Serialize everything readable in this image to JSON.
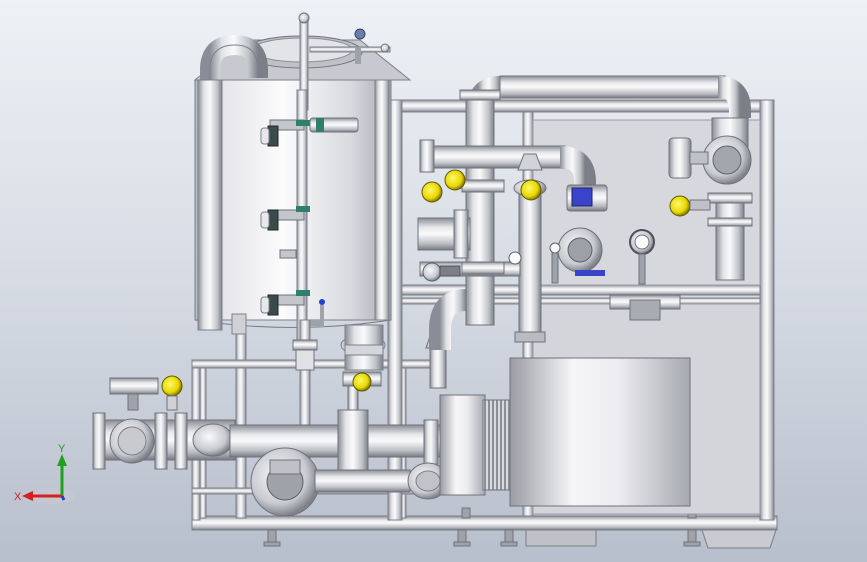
{
  "viewport": {
    "background_top": "#eef1f5",
    "background_bottom": "#b7bfcc"
  },
  "colors": {
    "steel_light": "#f4f4f6",
    "steel_mid": "#c4c6cc",
    "steel_dark": "#7c7f88",
    "frame_light": "#e9eaee",
    "frame_dark": "#9a9ca4",
    "valve_yellow": "#f2e200",
    "valve_dark": "#404040",
    "gauge_blue": "#3a44c8",
    "axis_x": "#d42020",
    "axis_y": "#20a020",
    "axis_z": "#2040d0"
  },
  "icons": {
    "storage_tank": "storage-tank-icon",
    "pump_motor": "motor-icon",
    "centrifugal_pump": "pump-icon",
    "butterfly_valve": "butterfly-valve-icon",
    "pressure_gauge": "pressure-gauge-icon",
    "axis_triad": "axis-triad-icon"
  },
  "axis_triad": {
    "x_label": "X",
    "y_label": "Y"
  }
}
